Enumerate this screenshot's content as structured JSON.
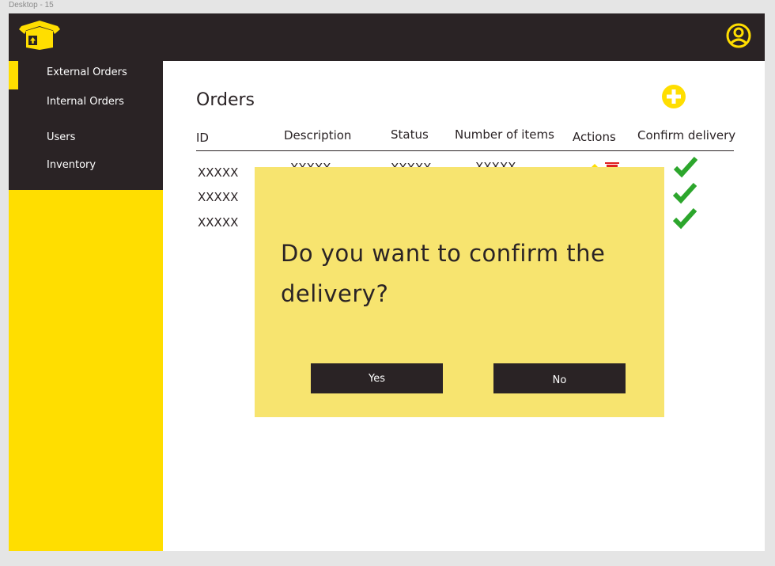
{
  "frame": {
    "label": "Desktop - 15"
  },
  "colors": {
    "accent": "#ffde00",
    "dark": "#2a2325",
    "modal_bg": "#f7e46f",
    "check": "#2ca62c",
    "delete": "#e02020"
  },
  "header": {
    "logo_icon": "box-icon",
    "profile_icon": "user-circle-icon"
  },
  "sidebar": {
    "items": [
      {
        "label": "External Orders",
        "active": true
      },
      {
        "label": "Internal Orders",
        "active": false
      },
      {
        "label": "Users",
        "active": false
      },
      {
        "label": "Inventory",
        "active": false
      }
    ]
  },
  "main": {
    "title": "Orders",
    "add_icon": "plus-circle-icon",
    "table": {
      "columns": [
        "ID",
        "Description",
        "Status",
        "Number of items",
        "Actions",
        "Confirm delivery"
      ],
      "rows": [
        {
          "id": "XXXXX",
          "description": "XXXXX",
          "status": "XXXXX",
          "items": "XXXXX"
        },
        {
          "id": "XXXXX"
        },
        {
          "id": "XXXXX"
        }
      ]
    }
  },
  "modal": {
    "message": "Do you want to confirm the delivery?",
    "yes_label": "Yes",
    "no_label": "No"
  }
}
